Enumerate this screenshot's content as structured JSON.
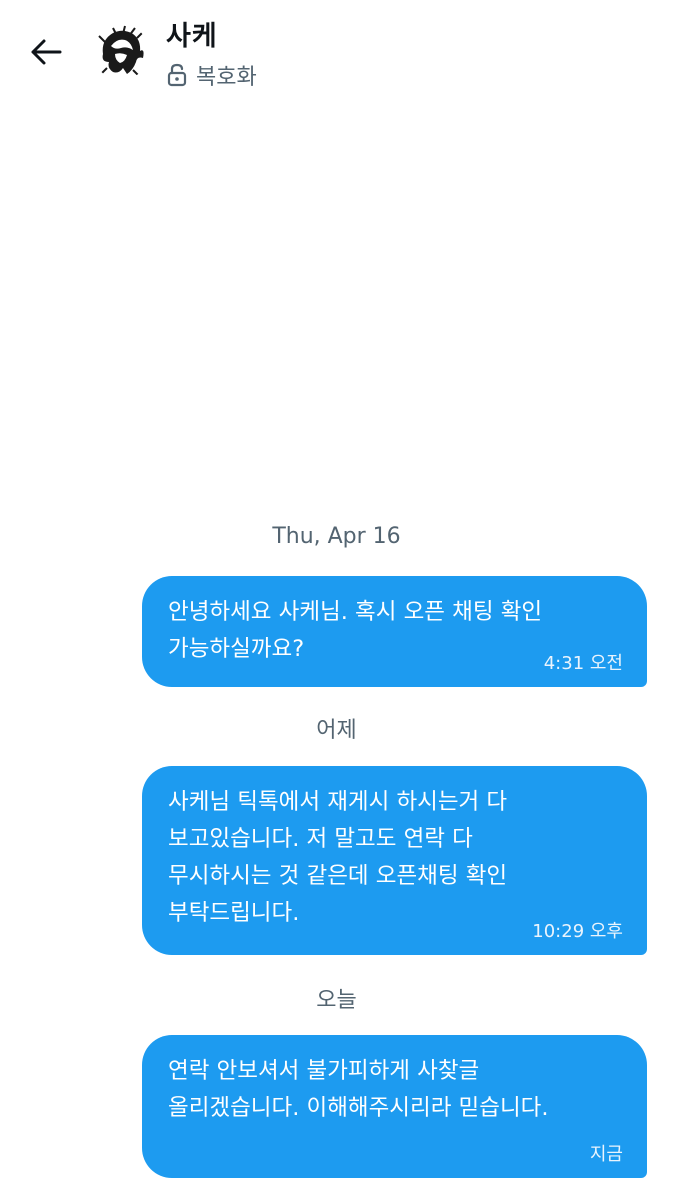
{
  "header": {
    "contact_name": "사케",
    "encryption_label": "복호화"
  },
  "icons": {
    "back": "arrow-left-icon",
    "lock": "unlock-icon"
  },
  "colors": {
    "bubble": "#1d9bf0",
    "secondary_text": "#536471"
  },
  "dates": {
    "first": "Thu, Apr 16",
    "yesterday": "어제",
    "today": "오늘"
  },
  "messages": [
    {
      "text": "안녕하세요 사케님. 혹시 오픈 채팅 확인\n가능하실까요?",
      "time": "4:31 오전"
    },
    {
      "text": "사케님 틱톡에서 재게시 하시는거 다\n보고있습니다. 저 말고도 연락 다\n무시하시는 것 같은데 오픈채팅 확인\n부탁드립니다.",
      "time": "10:29 오후"
    },
    {
      "text": "연락 안보셔서 불가피하게 사찾글\n올리겠습니다. 이해해주시리라 믿습니다.",
      "time": "지금"
    }
  ]
}
